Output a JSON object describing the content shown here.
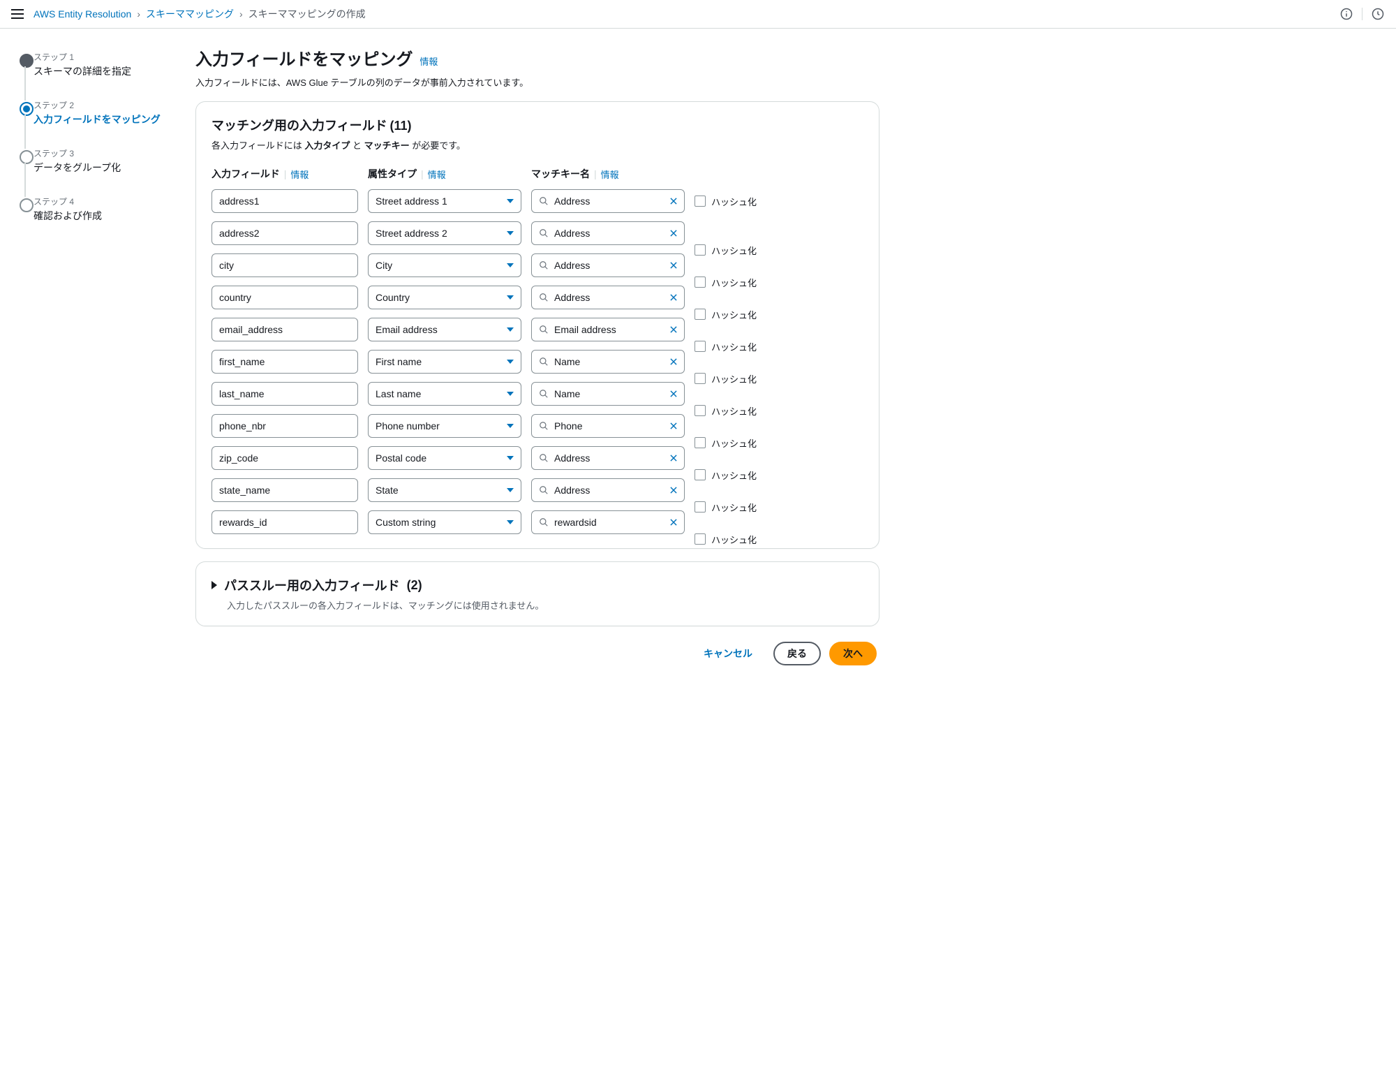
{
  "breadcrumb": {
    "root": "AWS Entity Resolution",
    "level1": "スキーママッピング",
    "current": "スキーママッピングの作成"
  },
  "stepper": [
    {
      "label": "ステップ 1",
      "title": "スキーマの詳細を指定",
      "state": "done"
    },
    {
      "label": "ステップ 2",
      "title": "入力フィールドをマッピング",
      "state": "active"
    },
    {
      "label": "ステップ 3",
      "title": "データをグループ化",
      "state": "pending"
    },
    {
      "label": "ステップ 4",
      "title": "確認および作成",
      "state": "pending"
    }
  ],
  "page": {
    "title": "入力フィールドをマッピング",
    "info": "情報",
    "description": "入力フィールドには、AWS Glue テーブルの列のデータが事前入力されています。"
  },
  "panel_match": {
    "title": "マッチング用の入力フィールド",
    "count": "(11)",
    "desc_pre": "各入力フィールドには ",
    "desc_b1": "入力タイプ",
    "desc_mid": " と ",
    "desc_b2": "マッチキー",
    "desc_post": " が必要です。",
    "cols": {
      "c1": "入力フィールド",
      "c2": "属性タイプ",
      "c3": "マッチキー名",
      "info": "情報",
      "hash": "ハッシュ化"
    },
    "rows": [
      {
        "field": "address1",
        "type": "Street address 1",
        "key": "Address"
      },
      {
        "field": "address2",
        "type": "Street address 2",
        "key": "Address"
      },
      {
        "field": "city",
        "type": "City",
        "key": "Address"
      },
      {
        "field": "country",
        "type": "Country",
        "key": "Address"
      },
      {
        "field": "email_address",
        "type": "Email address",
        "key": "Email address"
      },
      {
        "field": "first_name",
        "type": "First name",
        "key": "Name"
      },
      {
        "field": "last_name",
        "type": "Last name",
        "key": "Name"
      },
      {
        "field": "phone_nbr",
        "type": "Phone number",
        "key": "Phone"
      },
      {
        "field": "zip_code",
        "type": "Postal code",
        "key": "Address"
      },
      {
        "field": "state_name",
        "type": "State",
        "key": "Address"
      },
      {
        "field": "rewards_id",
        "type": "Custom string",
        "key": "rewardsid"
      }
    ]
  },
  "panel_pass": {
    "title": "パススルー用の入力フィールド",
    "count": "(2)",
    "desc": "入力したパススルーの各入力フィールドは、マッチングには使用されません。"
  },
  "footer": {
    "cancel": "キャンセル",
    "back": "戻る",
    "next": "次へ"
  }
}
